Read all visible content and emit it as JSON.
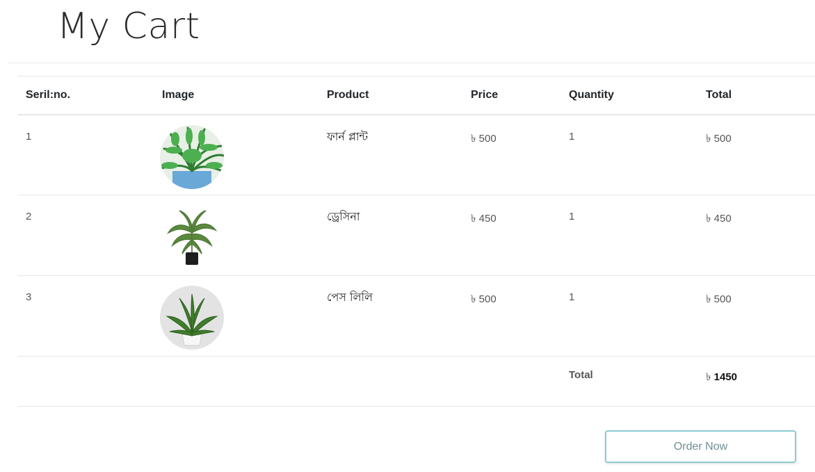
{
  "page": {
    "title": "My Cart"
  },
  "table": {
    "headers": [
      "Seril:no.",
      "Image",
      "Product",
      "Price",
      "Quantity",
      "Total"
    ],
    "rows": [
      {
        "serial": "1",
        "image": "fern-plant-image",
        "product": "ফার্ন প্লান্ট",
        "price": "৳ 500",
        "quantity": "1",
        "total": "৳ 500"
      },
      {
        "serial": "2",
        "image": "dracaena-plant-image",
        "product": "ড্রেসিনা",
        "price": "৳ 450",
        "quantity": "1",
        "total": "৳ 450"
      },
      {
        "serial": "3",
        "image": "peace-lily-plant-image",
        "product": "পেস লিলি",
        "price": "৳ 500",
        "quantity": "1",
        "total": "৳ 500"
      }
    ],
    "footer": {
      "label": "Total",
      "currency": "৳",
      "amount": "1450"
    }
  },
  "actions": {
    "order_label": "Order Now"
  },
  "colors": {
    "button_border": "#8ecbd3",
    "divider": "#e6e6e6"
  }
}
